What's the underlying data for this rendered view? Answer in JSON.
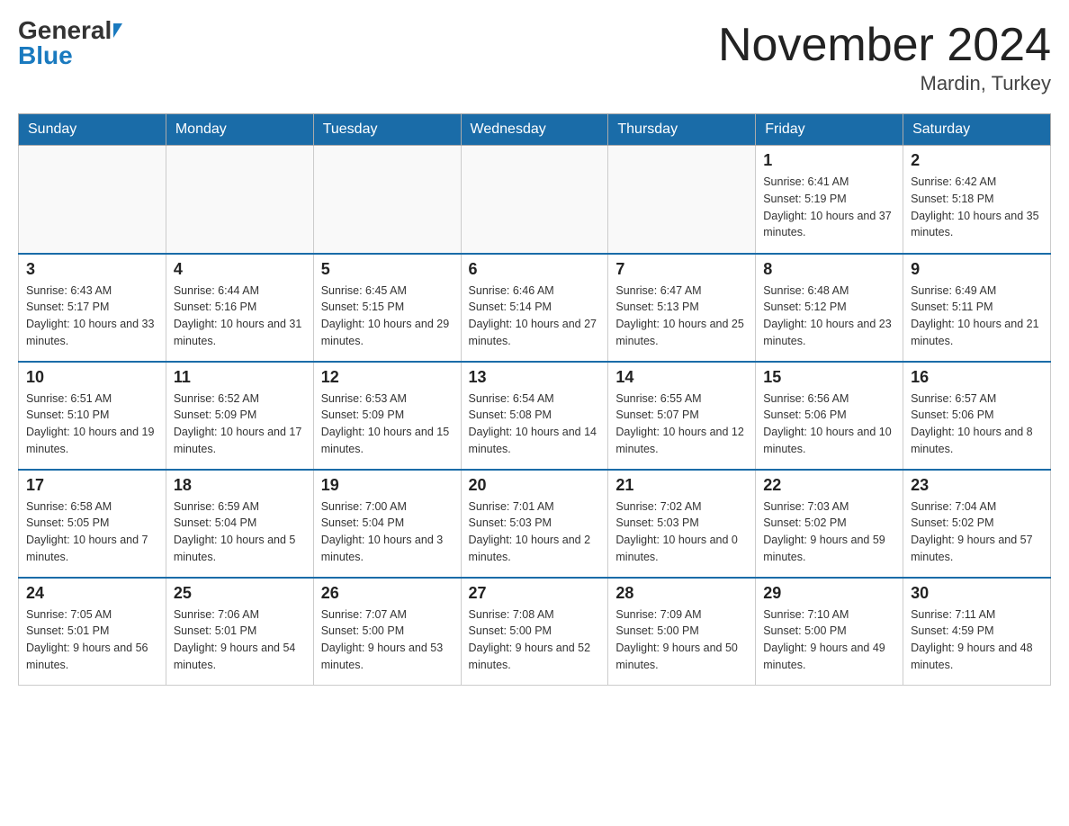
{
  "header": {
    "logo_general": "General",
    "logo_blue": "Blue",
    "month_title": "November 2024",
    "location": "Mardin, Turkey"
  },
  "days_of_week": [
    "Sunday",
    "Monday",
    "Tuesday",
    "Wednesday",
    "Thursday",
    "Friday",
    "Saturday"
  ],
  "weeks": [
    [
      {
        "day": "",
        "sunrise": "",
        "sunset": "",
        "daylight": ""
      },
      {
        "day": "",
        "sunrise": "",
        "sunset": "",
        "daylight": ""
      },
      {
        "day": "",
        "sunrise": "",
        "sunset": "",
        "daylight": ""
      },
      {
        "day": "",
        "sunrise": "",
        "sunset": "",
        "daylight": ""
      },
      {
        "day": "",
        "sunrise": "",
        "sunset": "",
        "daylight": ""
      },
      {
        "day": "1",
        "sunrise": "6:41 AM",
        "sunset": "5:19 PM",
        "daylight": "10 hours and 37 minutes."
      },
      {
        "day": "2",
        "sunrise": "6:42 AM",
        "sunset": "5:18 PM",
        "daylight": "10 hours and 35 minutes."
      }
    ],
    [
      {
        "day": "3",
        "sunrise": "6:43 AM",
        "sunset": "5:17 PM",
        "daylight": "10 hours and 33 minutes."
      },
      {
        "day": "4",
        "sunrise": "6:44 AM",
        "sunset": "5:16 PM",
        "daylight": "10 hours and 31 minutes."
      },
      {
        "day": "5",
        "sunrise": "6:45 AM",
        "sunset": "5:15 PM",
        "daylight": "10 hours and 29 minutes."
      },
      {
        "day": "6",
        "sunrise": "6:46 AM",
        "sunset": "5:14 PM",
        "daylight": "10 hours and 27 minutes."
      },
      {
        "day": "7",
        "sunrise": "6:47 AM",
        "sunset": "5:13 PM",
        "daylight": "10 hours and 25 minutes."
      },
      {
        "day": "8",
        "sunrise": "6:48 AM",
        "sunset": "5:12 PM",
        "daylight": "10 hours and 23 minutes."
      },
      {
        "day": "9",
        "sunrise": "6:49 AM",
        "sunset": "5:11 PM",
        "daylight": "10 hours and 21 minutes."
      }
    ],
    [
      {
        "day": "10",
        "sunrise": "6:51 AM",
        "sunset": "5:10 PM",
        "daylight": "10 hours and 19 minutes."
      },
      {
        "day": "11",
        "sunrise": "6:52 AM",
        "sunset": "5:09 PM",
        "daylight": "10 hours and 17 minutes."
      },
      {
        "day": "12",
        "sunrise": "6:53 AM",
        "sunset": "5:09 PM",
        "daylight": "10 hours and 15 minutes."
      },
      {
        "day": "13",
        "sunrise": "6:54 AM",
        "sunset": "5:08 PM",
        "daylight": "10 hours and 14 minutes."
      },
      {
        "day": "14",
        "sunrise": "6:55 AM",
        "sunset": "5:07 PM",
        "daylight": "10 hours and 12 minutes."
      },
      {
        "day": "15",
        "sunrise": "6:56 AM",
        "sunset": "5:06 PM",
        "daylight": "10 hours and 10 minutes."
      },
      {
        "day": "16",
        "sunrise": "6:57 AM",
        "sunset": "5:06 PM",
        "daylight": "10 hours and 8 minutes."
      }
    ],
    [
      {
        "day": "17",
        "sunrise": "6:58 AM",
        "sunset": "5:05 PM",
        "daylight": "10 hours and 7 minutes."
      },
      {
        "day": "18",
        "sunrise": "6:59 AM",
        "sunset": "5:04 PM",
        "daylight": "10 hours and 5 minutes."
      },
      {
        "day": "19",
        "sunrise": "7:00 AM",
        "sunset": "5:04 PM",
        "daylight": "10 hours and 3 minutes."
      },
      {
        "day": "20",
        "sunrise": "7:01 AM",
        "sunset": "5:03 PM",
        "daylight": "10 hours and 2 minutes."
      },
      {
        "day": "21",
        "sunrise": "7:02 AM",
        "sunset": "5:03 PM",
        "daylight": "10 hours and 0 minutes."
      },
      {
        "day": "22",
        "sunrise": "7:03 AM",
        "sunset": "5:02 PM",
        "daylight": "9 hours and 59 minutes."
      },
      {
        "day": "23",
        "sunrise": "7:04 AM",
        "sunset": "5:02 PM",
        "daylight": "9 hours and 57 minutes."
      }
    ],
    [
      {
        "day": "24",
        "sunrise": "7:05 AM",
        "sunset": "5:01 PM",
        "daylight": "9 hours and 56 minutes."
      },
      {
        "day": "25",
        "sunrise": "7:06 AM",
        "sunset": "5:01 PM",
        "daylight": "9 hours and 54 minutes."
      },
      {
        "day": "26",
        "sunrise": "7:07 AM",
        "sunset": "5:00 PM",
        "daylight": "9 hours and 53 minutes."
      },
      {
        "day": "27",
        "sunrise": "7:08 AM",
        "sunset": "5:00 PM",
        "daylight": "9 hours and 52 minutes."
      },
      {
        "day": "28",
        "sunrise": "7:09 AM",
        "sunset": "5:00 PM",
        "daylight": "9 hours and 50 minutes."
      },
      {
        "day": "29",
        "sunrise": "7:10 AM",
        "sunset": "5:00 PM",
        "daylight": "9 hours and 49 minutes."
      },
      {
        "day": "30",
        "sunrise": "7:11 AM",
        "sunset": "4:59 PM",
        "daylight": "9 hours and 48 minutes."
      }
    ]
  ]
}
